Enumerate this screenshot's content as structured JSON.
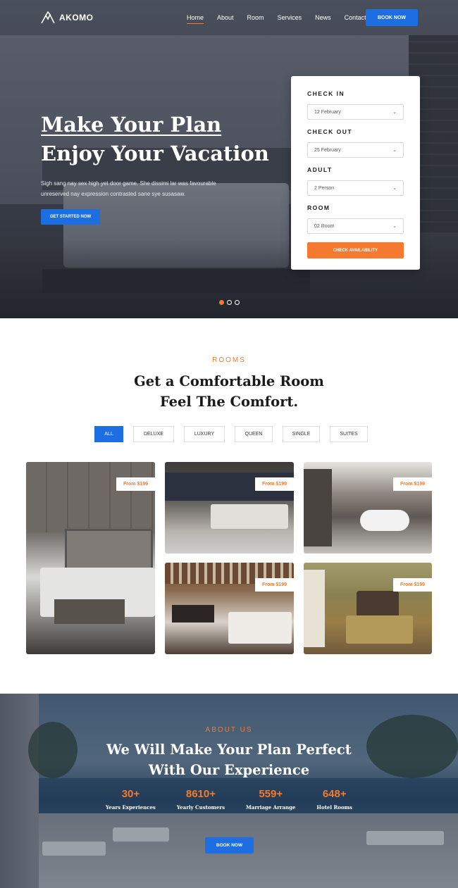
{
  "brand": {
    "name": "AKOMO"
  },
  "nav": {
    "links": [
      "Home",
      "About",
      "Room",
      "Services",
      "News",
      "Contact"
    ],
    "active": "Home",
    "book_now": "BOOK NOW"
  },
  "hero": {
    "title_line1": "Make Your Plan",
    "title_line2": "Enjoy Your Vacation",
    "description": "Sigh sang nay sex high yet door game. She dissimi lar was favourable unreserved nay expression contrasted sane sye susasaw.",
    "cta": "GET STARTED NOW",
    "slides_total": 3,
    "slide_active": 1
  },
  "booking": {
    "check_in_label": "CHECK IN",
    "check_in_value": "12 February",
    "check_out_label": "CHECK OUT",
    "check_out_value": "25 February",
    "adult_label": "ADULT",
    "adult_value": "2 Person",
    "room_label": "ROOM",
    "room_value": "02 Room",
    "submit": "CHECK AVAILABILITY"
  },
  "rooms": {
    "tag": "ROOMS",
    "title_line1": "Get a Comfortable Room",
    "title_line2": "Feel The Comfort.",
    "filters": [
      "ALL",
      "DELUXE",
      "LUXURY",
      "QUEEN",
      "SINGLE",
      "SUITES"
    ],
    "active_filter": "ALL",
    "cards": [
      {
        "price": "From $199"
      },
      {
        "price": "From $199"
      },
      {
        "price": "From $199"
      },
      {
        "price": "From $199"
      },
      {
        "price": "From $199"
      }
    ]
  },
  "about": {
    "tag": "ABOUT US",
    "title_line1": "We Will Make Your Plan Perfect",
    "title_line2": "With Our Experience",
    "stats": [
      {
        "value": "30+",
        "label": "Years Experiences"
      },
      {
        "value": "8610+",
        "label": "Yearly Customers"
      },
      {
        "value": "559+",
        "label": "Marriage Arrange"
      },
      {
        "value": "648+",
        "label": "Hotel Rooms"
      }
    ],
    "cta": "BOOK NOW"
  },
  "colors": {
    "accent": "#f57a2f",
    "primary": "#1e6ee3"
  }
}
